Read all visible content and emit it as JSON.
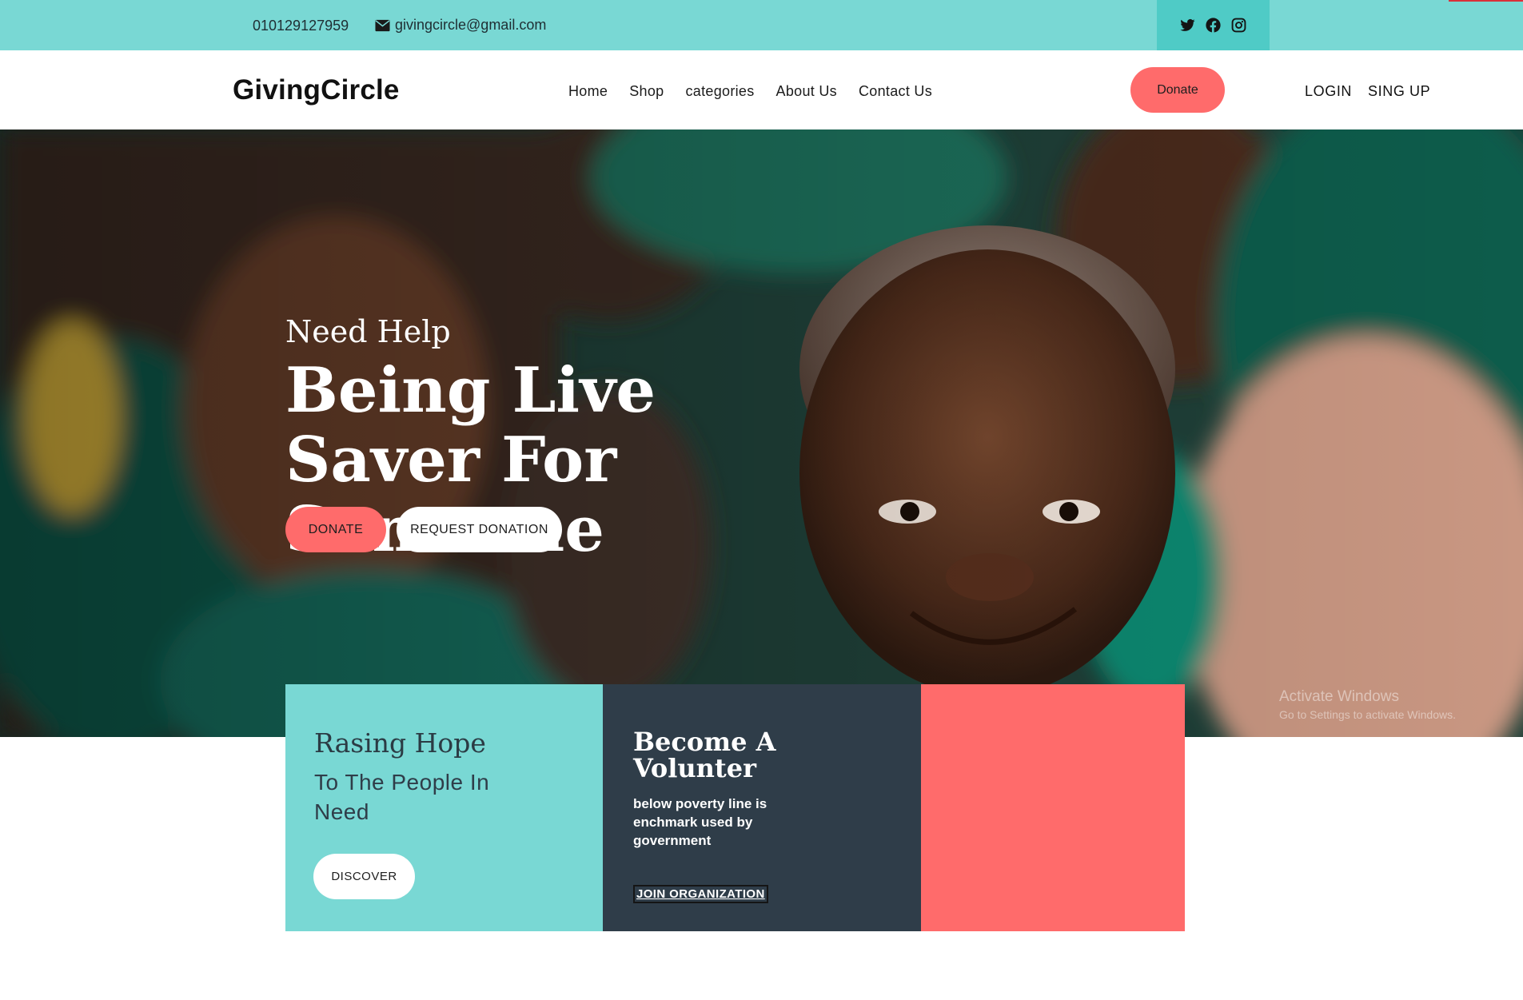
{
  "topbar": {
    "phone": "010129127959",
    "email": "givingcircle@gmail.com",
    "social_icons": [
      "twitter-icon",
      "facebook-icon",
      "instagram-icon"
    ]
  },
  "navbar": {
    "logo": "GivingCircle",
    "menu": [
      "Home",
      "Shop",
      "categories",
      "About Us",
      "Contact Us"
    ],
    "donate_label": "Donate",
    "login_label": "LOGIN",
    "signup_label": "SING UP"
  },
  "hero": {
    "eyebrow": "Need Help",
    "headline": "Being Live Saver For Someone",
    "donate_label": "DONATE",
    "request_label": "REQUEST DONATION"
  },
  "cards": {
    "hope": {
      "title": "Rasing Hope",
      "subtitle": "To The People In Need",
      "button": "DISCOVER"
    },
    "volunteer": {
      "title": "Become A Volunter",
      "text": "below poverty line is enchmark used by government",
      "link": "JOIN ORGANIZATION"
    }
  },
  "watermark": {
    "line1": "Activate Windows",
    "line2": "Go to Settings to activate Windows."
  },
  "colors": {
    "teal": "#79d8d4",
    "teal_dark": "#4fcbc6",
    "coral": "#ff6b6b",
    "navy": "#2f3d49"
  }
}
